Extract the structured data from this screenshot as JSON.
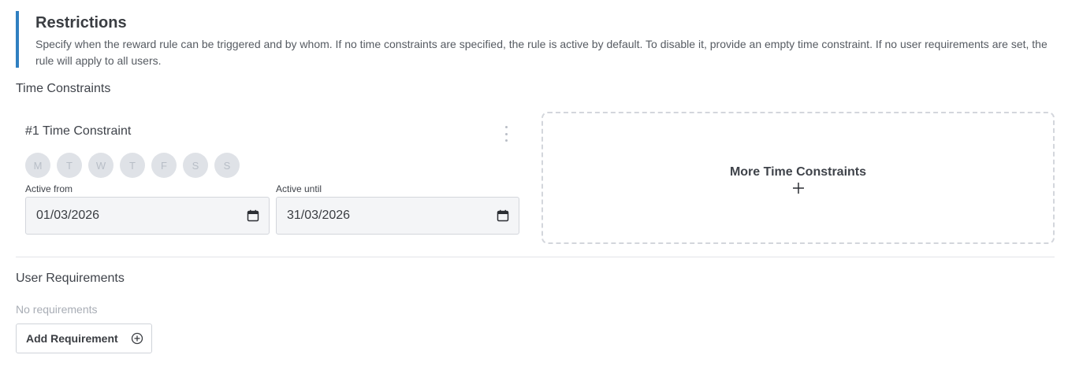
{
  "restrictions": {
    "title": "Restrictions",
    "description": "Specify when the reward rule can be triggered and by whom. If no time constraints are specified, the rule is active by default. To disable it, provide an empty time constraint. If no user requirements are set, the rule will apply to all users.",
    "accent_color": "#2f7fc1"
  },
  "time_constraints": {
    "section_title": "Time Constraints",
    "items": [
      {
        "title": "#1 Time Constraint",
        "menu_icon": "kebab-menu-icon",
        "days": [
          "M",
          "T",
          "W",
          "T",
          "F",
          "S",
          "S"
        ],
        "active_from": {
          "label": "Active from",
          "value": "01/03/2026",
          "icon": "calendar-icon"
        },
        "active_until": {
          "label": "Active until",
          "value": "31/03/2026",
          "icon": "calendar-icon"
        }
      }
    ],
    "more": {
      "label": "More Time Constraints",
      "icon": "plus-icon"
    }
  },
  "user_requirements": {
    "section_title": "User Requirements",
    "empty_text": "No requirements",
    "add_button": {
      "label": "Add Requirement",
      "icon": "plus-circle-icon"
    }
  }
}
